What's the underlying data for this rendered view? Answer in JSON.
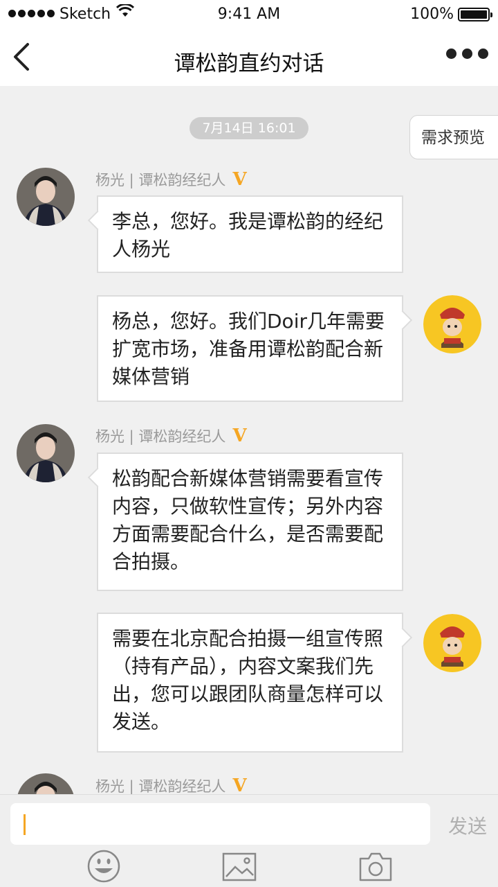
{
  "status_bar": {
    "carrier": "Sketch",
    "time": "9:41 AM",
    "battery": "100%"
  },
  "nav": {
    "title": "谭松韵直约对话"
  },
  "chat": {
    "timestamp": "7月14日 16:01",
    "preview_button": "需求预览",
    "messages": [
      {
        "side": "left",
        "sender": "杨光 | 谭松韵经纪人",
        "badge": "V",
        "text": "李总，您好。我是谭松韵的经纪人杨光"
      },
      {
        "side": "right",
        "text": "杨总，您好。我们Doir几年需要扩宽市场，准备用谭松韵配合新媒体营销"
      },
      {
        "side": "left",
        "sender": "杨光 | 谭松韵经纪人",
        "badge": "V",
        "text": "松韵配合新媒体营销需要看宣传内容，只做软性宣传；另外内容方面需要配合什么，是否需要配合拍摄。"
      },
      {
        "side": "right",
        "text": "需要在北京配合拍摄一组宣传照（持有产品），内容文案我们先出，您可以跟团队商量怎样可以发送。"
      },
      {
        "side": "left",
        "sender": "杨光 | 谭松韵经纪人",
        "badge": "V",
        "text": ""
      }
    ]
  },
  "composer": {
    "input_value": "",
    "send_label": "发送"
  },
  "colors": {
    "accent": "#f5a623",
    "background": "#f0f0f0"
  }
}
